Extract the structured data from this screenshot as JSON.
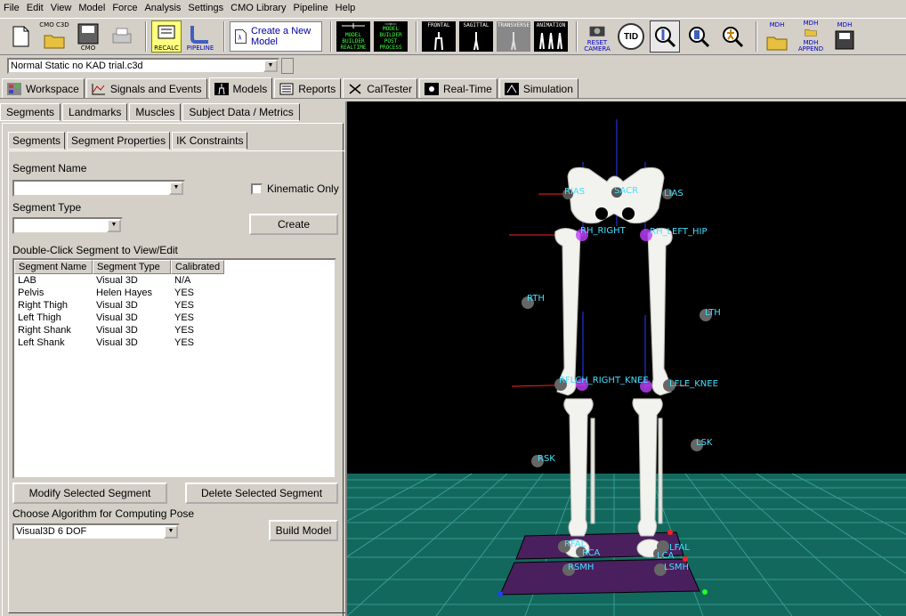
{
  "menu": [
    "File",
    "Edit",
    "View",
    "Model",
    "Force",
    "Analysis",
    "Settings",
    "CMO Library",
    "Pipeline",
    "Help"
  ],
  "toolbar": {
    "open_cmo_c3d": "CMO C3D",
    "cmo": "CMO",
    "recalc": "RECALC",
    "pipeline": "PIPELINE",
    "create_model": "Create a New Model",
    "model_builder_realtime": "MODEL BUILDER REALTIME",
    "model_builder_post": "MODEL BUILDER POST PROCESS",
    "frontal": "FRONTAL",
    "sagittal": "SAGITTAL",
    "transverse": "TRANSVERSE",
    "animation": "ANIMATION",
    "reset_camera": "RESET CAMERA",
    "tid": "TID",
    "mdh": "MDH",
    "mdh_append": "MDH APPEND",
    "mdh2": "MDH"
  },
  "file": {
    "current": "Normal Static no KAD trial.c3d"
  },
  "main_tabs": [
    "Workspace",
    "Signals and Events",
    "Models",
    "Reports",
    "CalTester",
    "Real-Time",
    "Simulation"
  ],
  "model_tabs": [
    "Segments",
    "Landmarks",
    "Muscles",
    "Subject Data / Metrics"
  ],
  "segment_tabs": [
    "Segments",
    "Segment Properties",
    "IK Constraints"
  ],
  "segments_panel": {
    "segment_name_label": "Segment Name",
    "segment_name_value": "",
    "kinematic_only_label": "Kinematic Only",
    "segment_type_label": "Segment Type",
    "segment_type_value": "",
    "create_button": "Create",
    "list_label": "Double-Click Segment to View/Edit",
    "columns": [
      "Segment Name",
      "Segment Type",
      "Calibrated"
    ],
    "rows": [
      [
        "LAB",
        "Visual 3D",
        "N/A"
      ],
      [
        "Pelvis",
        "Helen Hayes",
        "YES"
      ],
      [
        "Right Thigh",
        "Visual 3D",
        "YES"
      ],
      [
        "Left Thigh",
        "Visual 3D",
        "YES"
      ],
      [
        "Right Shank",
        "Visual 3D",
        "YES"
      ],
      [
        "Left Shank",
        "Visual 3D",
        "YES"
      ]
    ],
    "modify_button": "Modify Selected Segment",
    "delete_button": "Delete Selected Segment",
    "algorithm_label": "Choose Algorithm for Computing Pose",
    "algorithm_value": "Visual3D 6 DOF",
    "build_button": "Build Model"
  },
  "viewport": {
    "labels": [
      "RIAS",
      "SACR",
      "LIAS",
      "RH_RIGHT",
      "RH_LEFT_HIP",
      "RTH",
      "LTH",
      "RFLCH_RIGHT_KNEE",
      "LFLE_KNEE",
      "LSK",
      "RSK",
      "RFAL",
      "RCA",
      "LFAL",
      "LCA",
      "RSMH",
      "LSMH"
    ],
    "colors": {
      "background": "#000000",
      "floor": "#1a7a6e",
      "bone": "#f2f2ee",
      "label": "#40e0ff",
      "plate": "#4a1f5e"
    }
  }
}
